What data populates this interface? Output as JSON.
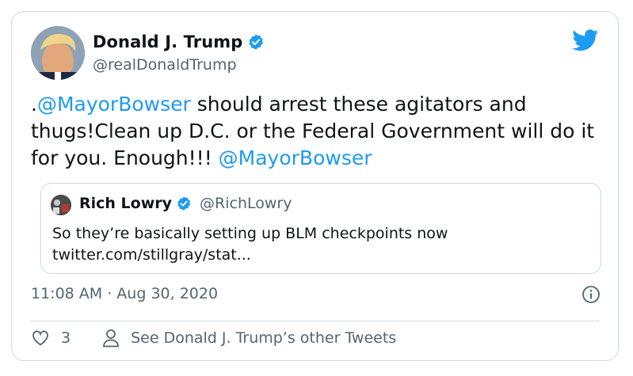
{
  "author": {
    "name": "Donald J. Trump",
    "handle": "@realDonaldTrump",
    "verified": true
  },
  "tweet": {
    "text_prefix": ".",
    "mention_1": "@MayorBowser",
    "text_body": " should arrest these agitators and thugs!Clean up D.C. or the Federal Government will do it for you. Enough!!! ",
    "mention_2": "@MayorBowser"
  },
  "quoted_tweet": {
    "name": "Rich Lowry",
    "handle": "@RichLowry",
    "verified": true,
    "text_line_1": "So they’re basically setting up BLM checkpoints now",
    "text_line_2": "twitter.com/stillgray/stat..."
  },
  "meta": {
    "timestamp": "11:08 AM · Aug 30, 2020"
  },
  "actions": {
    "like_count": "3",
    "other_tweets_label": "See Donald J. Trump’s other Tweets"
  },
  "icons": {
    "brand": "twitter-bird-icon",
    "verified": "verified-badge-icon",
    "info": "info-icon",
    "like": "heart-icon",
    "profile": "person-icon"
  },
  "colors": {
    "accent": "#1d9bf0",
    "text": "#0f1419",
    "muted": "#536471",
    "border": "#cfd9de"
  }
}
